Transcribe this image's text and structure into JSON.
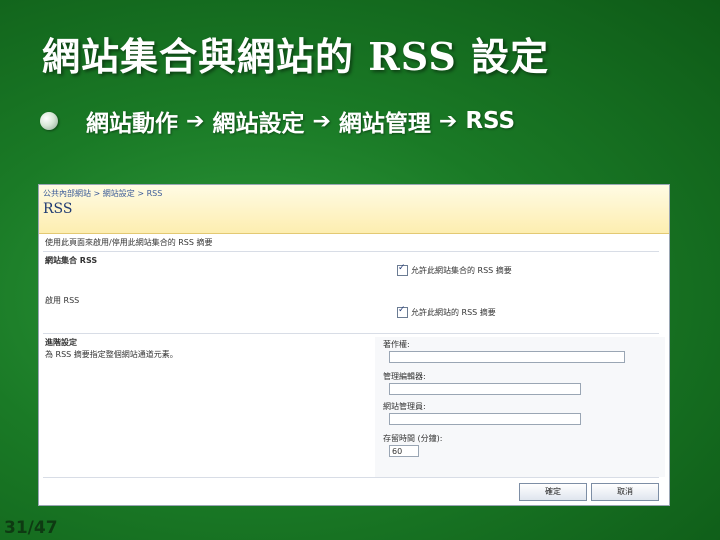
{
  "slide": {
    "title": "網站集合與網站的 RSS 設定",
    "breadcrumb": [
      "網站動作",
      "網站設定",
      "網站管理",
      "RSS"
    ],
    "arrow_glyph": "➔",
    "page_number": "31/47"
  },
  "screenshot": {
    "breadcrumb": "公共內部網站 > 網站設定 > RSS",
    "title": "RSS",
    "intro": "使用此頁面來啟用/停用此網站集合的 RSS 摘要",
    "site_collection_section": "網站集合 RSS",
    "site_collection_checkbox": "允許此網站集合的 RSS 摘要",
    "enable_section": "啟用 RSS",
    "enable_checkbox": "允許此網站的 RSS 摘要",
    "advanced_section": "進階設定",
    "advanced_desc": "為 RSS 摘要指定整個網站通道元素。",
    "copyright_label": "著作權:",
    "copyright_value": "",
    "managing_editor_label": "管理編輯器:",
    "managing_editor_value": "",
    "webmaster_label": "網站管理員:",
    "webmaster_value": "",
    "ttl_label": "存留時間 (分鐘):",
    "ttl_value": "60",
    "ok_button": "確定",
    "cancel_button": "取消"
  },
  "colors": {
    "background": "#1a7a26",
    "header_band": "#fdeeb0"
  }
}
